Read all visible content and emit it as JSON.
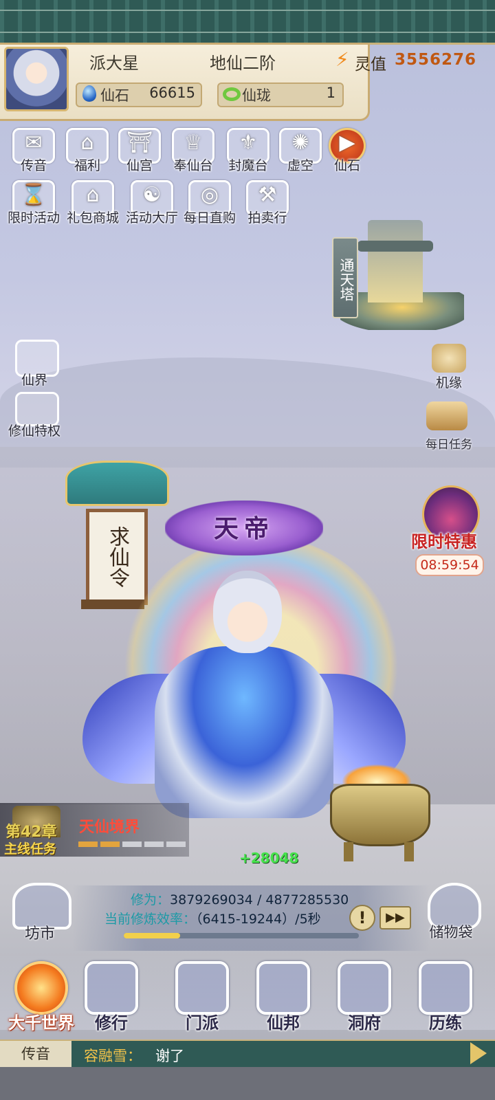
{
  "player": {
    "name": "派大星",
    "realm": "地仙二阶",
    "lingzhi_label": "灵值",
    "lingzhi_value": "3556276"
  },
  "resources": [
    {
      "label": "仙石",
      "value": "66615",
      "icon": "blue-gem-icon"
    },
    {
      "label": "仙珑",
      "value": "1",
      "icon": "jade-ring-icon"
    }
  ],
  "top_icons_row1": [
    {
      "label": "传音",
      "icon": "envelope-icon"
    },
    {
      "label": "福利",
      "icon": "gift-bag-icon"
    },
    {
      "label": "仙宫",
      "icon": "palace-icon"
    },
    {
      "label": "奉仙台",
      "icon": "altar-icon"
    },
    {
      "label": "封魔台",
      "icon": "demon-seal-icon"
    },
    {
      "label": "虚空",
      "icon": "void-icon"
    },
    {
      "label": "仙石",
      "icon": "play-video-icon"
    }
  ],
  "top_icons_row2": [
    {
      "label": "限时活动",
      "icon": "hourglass-icon"
    },
    {
      "label": "礼包商城",
      "icon": "shop-icon"
    },
    {
      "label": "活动大厅",
      "icon": "event-hall-icon"
    },
    {
      "label": "每日直购",
      "icon": "coin-icon"
    },
    {
      "label": "拍卖行",
      "icon": "gavel-icon"
    }
  ],
  "left_side": [
    {
      "label": "仙界",
      "icon": "cloud-realm-icon"
    },
    {
      "label": "修仙特权",
      "icon": "turtle-icon"
    }
  ],
  "right_side": [
    {
      "label": "机缘",
      "icon": "fortune-icon"
    },
    {
      "label": "每日任务",
      "icon": "scroll-icon"
    }
  ],
  "tower": {
    "label": "通天塔"
  },
  "gate": {
    "label": "求仙令"
  },
  "character": {
    "title": "天帝"
  },
  "limited_offer": {
    "label": "限时特惠",
    "timer": "08:59:54"
  },
  "chapter": {
    "number": "第42章",
    "task": "主线任务",
    "title": "天仙境界",
    "progress_segments": 5,
    "progress_done": 2
  },
  "gain": "+28048",
  "cultivation": {
    "label1": "修为：",
    "value1": "3879269034 / 4877285530",
    "label2": "当前修炼效率：",
    "value2": "（6415-19244）/5秒",
    "progress": 0.24
  },
  "left_bottom": {
    "label": "坊市"
  },
  "right_bottom": {
    "label": "储物袋"
  },
  "nav": [
    {
      "label": "大千世界",
      "icon": "world-icon",
      "active": true
    },
    {
      "label": "修行",
      "icon": "cultivate-icon"
    },
    {
      "label": "门派",
      "icon": "sect-icon"
    },
    {
      "label": "仙邦",
      "icon": "alliance-icon"
    },
    {
      "label": "洞府",
      "icon": "cave-dwelling-icon"
    },
    {
      "label": "历练",
      "icon": "sword-icon"
    }
  ],
  "chat": {
    "tab": "传音",
    "sender": "容融雪",
    "separator": "：",
    "message": "谢了"
  }
}
